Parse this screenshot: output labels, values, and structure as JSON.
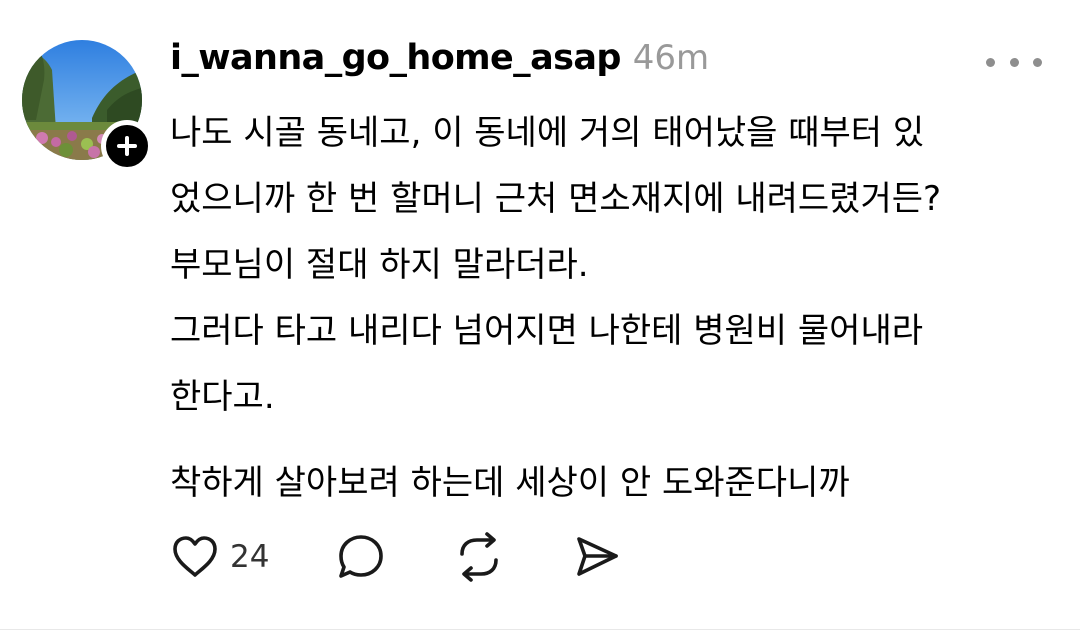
{
  "post": {
    "username": "i_wanna_go_home_asap",
    "time": "46m",
    "body_lines": [
      "나도 시골 동네고, 이 동네에 거의 태어났을 때부터 있",
      "었으니까 한 번 할머니 근처 면소재지에 내려드렸거든?",
      "부모님이 절대 하지 말라더라.",
      "그러다 타고 내리다 넘어지면 나한테 병원비 물어내라",
      "한다고."
    ],
    "closing_line": "착하게 살아보려 하는데 세상이 안 도와준다니까",
    "like_count": "24"
  },
  "icons": {
    "follow": "plus-icon",
    "more": "more-dots-icon",
    "like": "heart-icon",
    "comment": "comment-bubble-icon",
    "repost": "repost-icon",
    "share": "share-send-icon"
  },
  "colors": {
    "text": "#000000",
    "muted": "#999999",
    "icon": "#1a1a1a",
    "badge": "#000000"
  }
}
